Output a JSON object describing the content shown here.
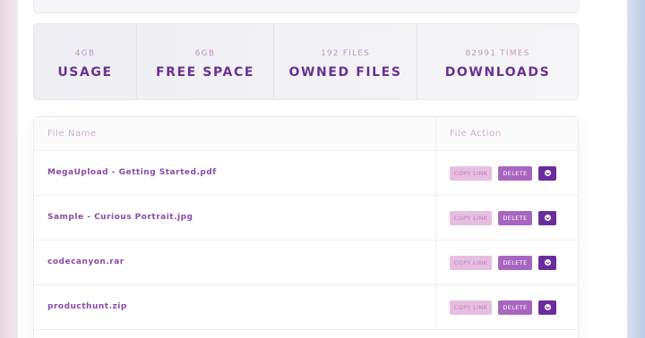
{
  "stats": [
    {
      "value": "4GB",
      "label": "USAGE"
    },
    {
      "value": "6GB",
      "label": "FREE SPACE"
    },
    {
      "value": "192 FILES",
      "label": "OWNED FILES"
    },
    {
      "value": "82991 TIMES",
      "label": "DOWNLOADS"
    }
  ],
  "table": {
    "headers": {
      "name": "File Name",
      "action": "File Action"
    },
    "actions": {
      "copy": "COPY LINK",
      "delete": "DELETE"
    },
    "rows": [
      {
        "name": "MegaUpload - Getting Started.pdf"
      },
      {
        "name": "Sample - Curious Portrait.jpg"
      },
      {
        "name": "codecanyon.rar"
      },
      {
        "name": "producthunt.zip"
      }
    ]
  }
}
